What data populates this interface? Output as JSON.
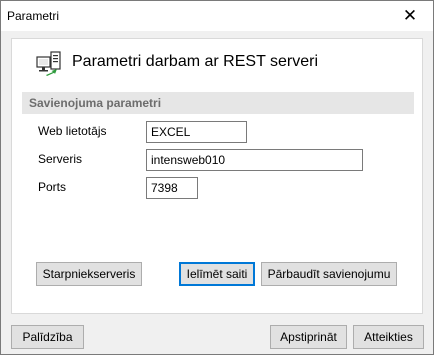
{
  "window": {
    "title": "Parametri",
    "close_glyph": "✕"
  },
  "header": {
    "title": "Parametri darbam ar REST serveri",
    "icon": "network-computer-icon"
  },
  "section": {
    "title": "Savienojuma parametri"
  },
  "fields": {
    "user": {
      "label": "Web lietotājs",
      "value": "EXCEL"
    },
    "server": {
      "label": "Serveris",
      "value": "intensweb010"
    },
    "port": {
      "label": "Ports",
      "value": "7398"
    }
  },
  "actions": {
    "proxy": "Starpniekserveris",
    "load_link": "Ielīmēt saiti",
    "check": "Pārbaudīt savienojumu"
  },
  "footer": {
    "help": "Palīdzība",
    "confirm": "Apstiprināt",
    "cancel": "Atteikties"
  },
  "colors": {
    "accent": "#0078d7",
    "panel_bg": "#ffffff",
    "window_bg": "#f0f0f0",
    "section_band": "#e6e6e6"
  }
}
